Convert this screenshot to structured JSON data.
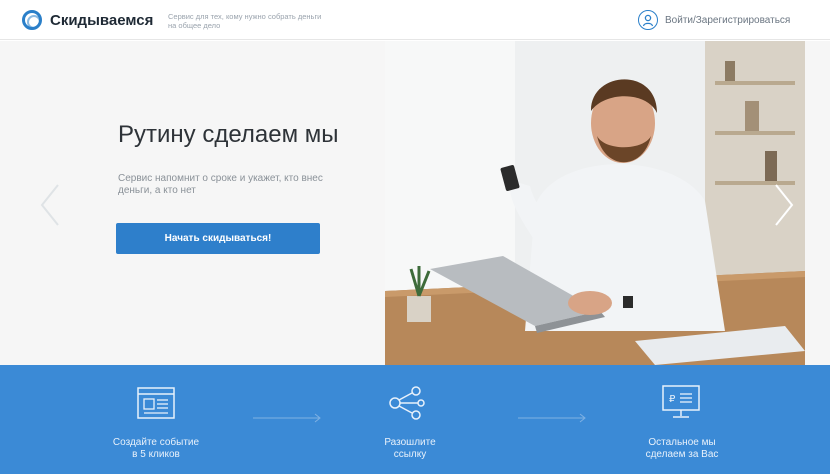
{
  "header": {
    "brand": "Скидываемся",
    "tagline": "Сервис для тех, кому нужно собрать деньги на общее дело",
    "login": "Войти/Зарегистрироваться"
  },
  "hero": {
    "title": "Рутину сделаем мы",
    "subtitle": "Сервис напомнит о сроке и укажет, кто внес деньги, а кто нет",
    "cta": "Начать скидываться!"
  },
  "steps": [
    {
      "label_line1": "Создайте событие",
      "label_line2": "в 5 кликов",
      "icon": "window-form-icon"
    },
    {
      "label_line1": "Разошлите",
      "label_line2": "ссылку",
      "icon": "share-icon"
    },
    {
      "label_line1": "Остальное мы",
      "label_line2": "сделаем за Вас",
      "icon": "monitor-ruble-icon"
    }
  ],
  "colors": {
    "accent": "#2e7fcb",
    "band": "#3b8ad6",
    "brand_text": "#1f2a35"
  }
}
